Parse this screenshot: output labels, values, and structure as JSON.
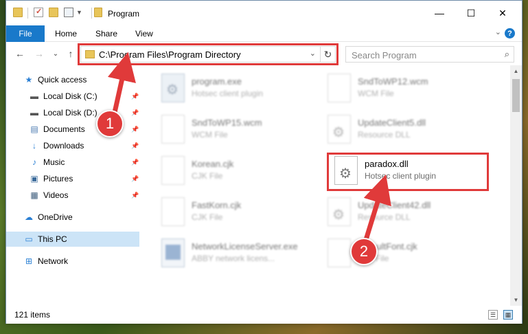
{
  "window": {
    "title": "Program",
    "minimize_icon": "minimize-icon",
    "maximize_icon": "maximize-icon",
    "close_icon": "close-icon",
    "min_glyph": "—",
    "max_glyph": "☐",
    "close_glyph": "✕"
  },
  "ribbon": {
    "tabs": [
      "File",
      "Home",
      "Share",
      "View"
    ],
    "help_glyph": "?",
    "collapse_glyph": "⌄"
  },
  "nav": {
    "back_glyph": "←",
    "forward_glyph": "→",
    "dropdown_glyph": "⌄",
    "up_glyph": "↑",
    "address": "C:\\Program Files\\Program Directory",
    "refresh_glyph": "↻",
    "search_placeholder": "Search Program",
    "search_glyph": "⌕"
  },
  "sidebar": {
    "items": [
      {
        "label": "Quick access",
        "icon": "star-icon",
        "glyph": "★"
      },
      {
        "label": "Local Disk (C:)",
        "icon": "drive-icon",
        "glyph": "▬",
        "pinned": true
      },
      {
        "label": "Local Disk (D:)",
        "icon": "drive-icon",
        "glyph": "▬",
        "pinned": true
      },
      {
        "label": "Documents",
        "icon": "documents-icon",
        "glyph": "▤",
        "pinned": true
      },
      {
        "label": "Downloads",
        "icon": "downloads-icon",
        "glyph": "↓",
        "pinned": true
      },
      {
        "label": "Music",
        "icon": "music-icon",
        "glyph": "♪",
        "pinned": true
      },
      {
        "label": "Pictures",
        "icon": "pictures-icon",
        "glyph": "▣",
        "pinned": true
      },
      {
        "label": "Videos",
        "icon": "videos-icon",
        "glyph": "▦",
        "pinned": true
      },
      {
        "label": "OneDrive",
        "icon": "cloud-icon",
        "glyph": "☁"
      },
      {
        "label": "This PC",
        "icon": "computer-icon",
        "glyph": "▭",
        "selected": true
      },
      {
        "label": "Network",
        "icon": "network-icon",
        "glyph": "⊞"
      }
    ],
    "pin_glyph": "📌"
  },
  "files": [
    {
      "name": "program.exe",
      "type": "Hotsec client plugin",
      "icon": "exe"
    },
    {
      "name": "SndToWP12.wcm",
      "type": "WCM File",
      "icon": "blank"
    },
    {
      "name": "SndToWP15.wcm",
      "type": "WCM File",
      "icon": "blank"
    },
    {
      "name": "UpdateClient5.dll",
      "type": "Resource DLL",
      "icon": "gear"
    },
    {
      "name": "Korean.cjk",
      "type": "CJK File",
      "icon": "blank"
    },
    {
      "name": "paradox.dll",
      "type": "Hotsec client plugin",
      "icon": "gear",
      "highlighted": true
    },
    {
      "name": "FastKorn.cjk",
      "type": "CJK File",
      "icon": "blank"
    },
    {
      "name": "UpdateClient42.dll",
      "type": "Resource DLL",
      "icon": "gear"
    },
    {
      "name": "NetworkLicenseServer.exe",
      "type": "ABBY network licens...",
      "icon": "app"
    },
    {
      "name": "DefaultFont.cjk",
      "type": "CJK File",
      "icon": "blank"
    }
  ],
  "status": {
    "item_count": "121 items",
    "details_glyph": "☰",
    "tiles_glyph": "▦"
  },
  "callouts": [
    "1",
    "2"
  ],
  "colors": {
    "accent": "#1979ca",
    "highlight": "#e03a3a",
    "selected_bg": "#cce4f7"
  }
}
